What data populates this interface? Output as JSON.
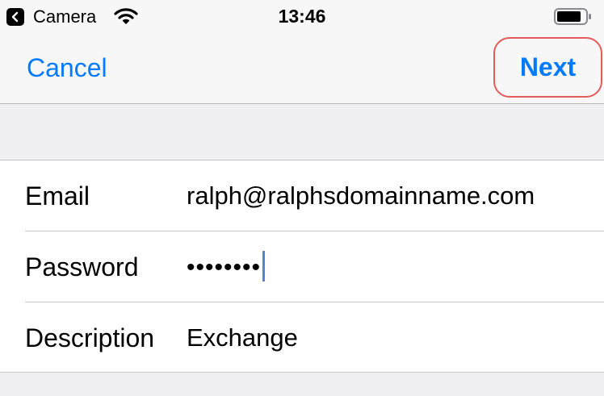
{
  "status_bar": {
    "back_app": "Camera",
    "time": "13:46",
    "icons": [
      "back-chevron-icon",
      "wifi-icon",
      "battery-icon"
    ]
  },
  "nav": {
    "cancel_label": "Cancel",
    "next_label": "Next"
  },
  "form": {
    "email": {
      "label": "Email",
      "value": "ralph@ralphsdomainname.com"
    },
    "password": {
      "label": "Password",
      "masked_value": "••••••••"
    },
    "description": {
      "label": "Description",
      "value": "Exchange"
    }
  },
  "colors": {
    "accent": "#007aff",
    "highlight_outline": "#e55a5a",
    "background": "#efeff4"
  }
}
